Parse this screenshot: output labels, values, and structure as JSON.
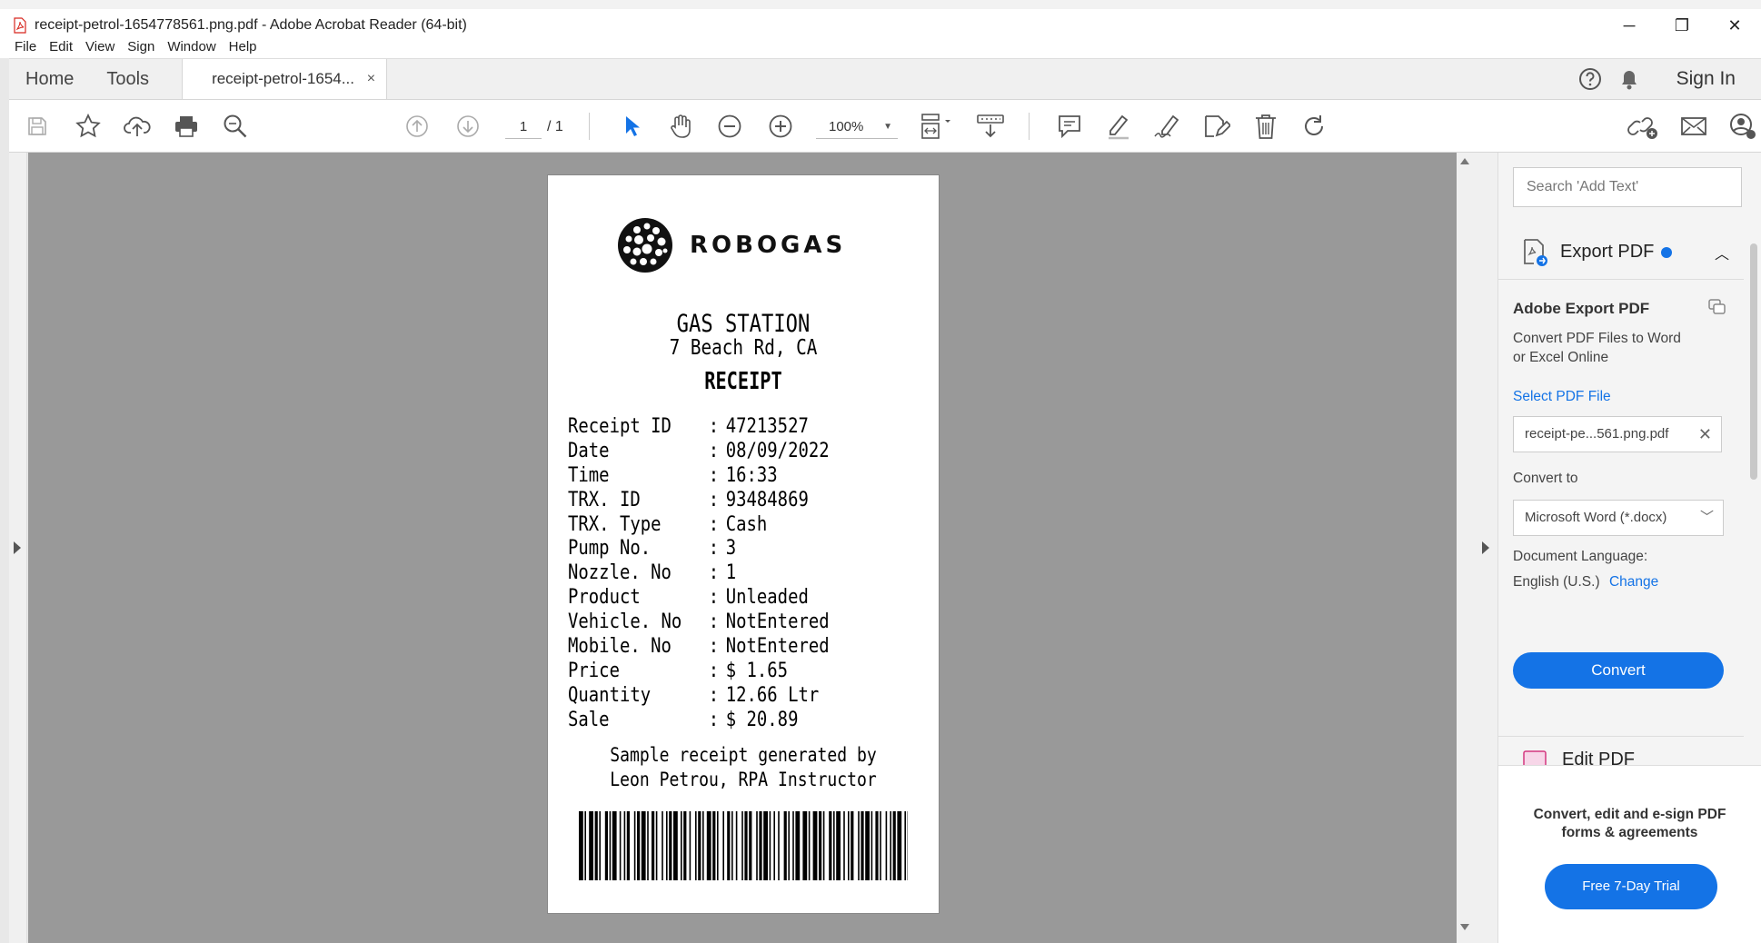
{
  "window": {
    "title": "receipt-petrol-1654778561.png.pdf - Adobe Acrobat Reader (64-bit)",
    "controls": {
      "minimize": "─",
      "maximize": "❐",
      "close": "✕"
    }
  },
  "menu": [
    "File",
    "Edit",
    "View",
    "Sign",
    "Window",
    "Help"
  ],
  "tabs": {
    "home": "Home",
    "tools": "Tools",
    "document": "receipt-petrol-1654...",
    "close": "×",
    "sign_in": "Sign In"
  },
  "toolbar": {
    "page_current": "1",
    "page_total": "/ 1",
    "zoom": "100%",
    "icons": [
      "save-icon",
      "star-icon",
      "cloud-upload-icon",
      "print-icon",
      "zoom-search-icon",
      "page-up-icon",
      "page-down-icon",
      "select-pointer-icon",
      "hand-icon",
      "zoom-out-icon",
      "zoom-in-icon",
      "fit-page-icon",
      "scroll-mode-icon",
      "comment-icon",
      "highlight-icon",
      "sign-icon",
      "edit-pdf-icon",
      "delete-icon",
      "rotate-icon",
      "share-link-icon",
      "email-icon",
      "account-icon"
    ]
  },
  "receipt": {
    "brand": "ROBOGAS",
    "station": "GAS STATION",
    "address": "7 Beach Rd, CA",
    "heading": "RECEIPT",
    "rows": [
      {
        "key": "Receipt ID",
        "value": "47213527"
      },
      {
        "key": "Date",
        "value": "08/09/2022"
      },
      {
        "key": "Time",
        "value": "16:33"
      },
      {
        "key": "TRX. ID",
        "value": "93484869"
      },
      {
        "key": "TRX. Type",
        "value": "Cash"
      },
      {
        "key": "Pump No.",
        "value": "3"
      },
      {
        "key": "Nozzle. No",
        "value": "1"
      },
      {
        "key": "Product",
        "value": "Unleaded"
      },
      {
        "key": "Vehicle. No",
        "value": "NotEntered"
      },
      {
        "key": "Mobile. No",
        "value": "NotEntered"
      },
      {
        "key": "Price",
        "value": "$ 1.65"
      },
      {
        "key": "Quantity",
        "value": "12.66 Ltr"
      },
      {
        "key": "Sale",
        "value": "$ 20.89"
      }
    ],
    "separator": ":",
    "footer_line1": "Sample receipt generated by",
    "footer_line2": "Leon Petrou, RPA Instructor"
  },
  "right_panel": {
    "search_placeholder": "Search 'Add Text'",
    "export_title": "Export PDF",
    "adobe_export_title": "Adobe Export PDF",
    "description_line1": "Convert PDF Files to Word",
    "description_line2": "or Excel Online",
    "select_pdf_link": "Select PDF File",
    "selected_file": "receipt-pe...561.png.pdf",
    "convert_to_label": "Convert to",
    "convert_to_value": "Microsoft Word (*.docx)",
    "doc_language_label": "Document Language:",
    "doc_language_value": "English (U.S.)",
    "change_link": "Change",
    "convert_button": "Convert",
    "edit_pdf_peek": "Edit PDF",
    "promo_line1": "Convert, edit and e-sign PDF",
    "promo_line2": "forms & agreements",
    "trial_button": "Free 7-Day Trial"
  },
  "colors": {
    "accent": "#1473e6",
    "doc_bg": "#999999",
    "pdf_icon": "#d7261e"
  }
}
